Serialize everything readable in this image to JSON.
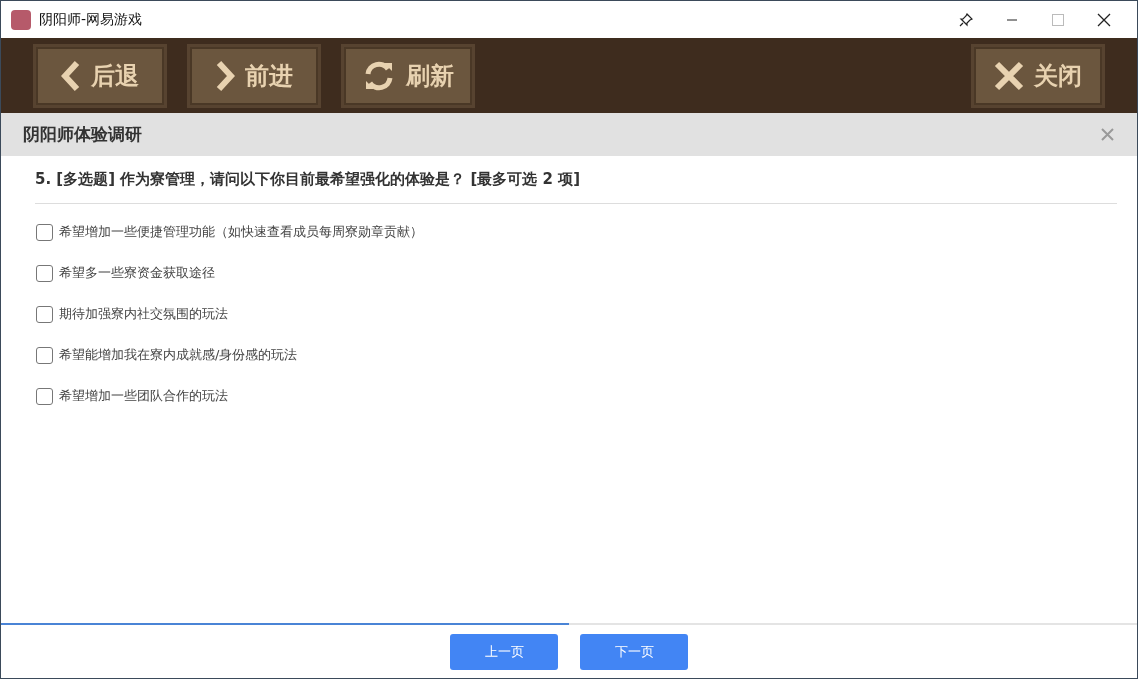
{
  "window": {
    "title": "阴阳师-网易游戏"
  },
  "toolbar": {
    "buttons": [
      {
        "kind": "back",
        "label": "后退"
      },
      {
        "kind": "forward",
        "label": "前进"
      },
      {
        "kind": "refresh",
        "label": "刷新"
      },
      {
        "kind": "close",
        "label": "关闭"
      }
    ]
  },
  "survey": {
    "title": "阴阳师体验调研",
    "question": "5. [多选题] 作为寮管理，请问以下你目前最希望强化的体验是？ [最多可选 2 项]",
    "options": [
      {
        "label": "希望增加一些便捷管理功能（如快速查看成员每周寮勋章贡献）",
        "checked": false
      },
      {
        "label": "希望多一些寮资金获取途径",
        "checked": false
      },
      {
        "label": "期待加强寮内社交氛围的玩法",
        "checked": false
      },
      {
        "label": "希望能增加我在寮内成就感/身份感的玩法",
        "checked": false
      },
      {
        "label": "希望增加一些团队合作的玩法",
        "checked": false
      }
    ]
  },
  "progress": {
    "level": 0.5
  },
  "footer": {
    "buttons": [
      "上一页",
      "下一页"
    ]
  }
}
